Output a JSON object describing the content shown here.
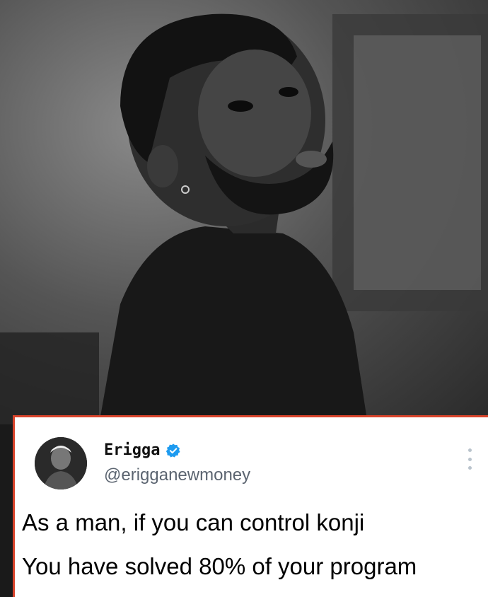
{
  "tweet": {
    "display_name": "Erigga",
    "handle": "@erigganewmoney",
    "verified_icon": "verified-badge-icon",
    "more_icon": "more-vertical-icon",
    "text_line_1": "As a man, if you can control konji",
    "text_line_2": "You have solved 80% of your program"
  },
  "colors": {
    "card_border": "#d9442b",
    "verified": "#1d9bf0",
    "handle": "#5b6470"
  }
}
